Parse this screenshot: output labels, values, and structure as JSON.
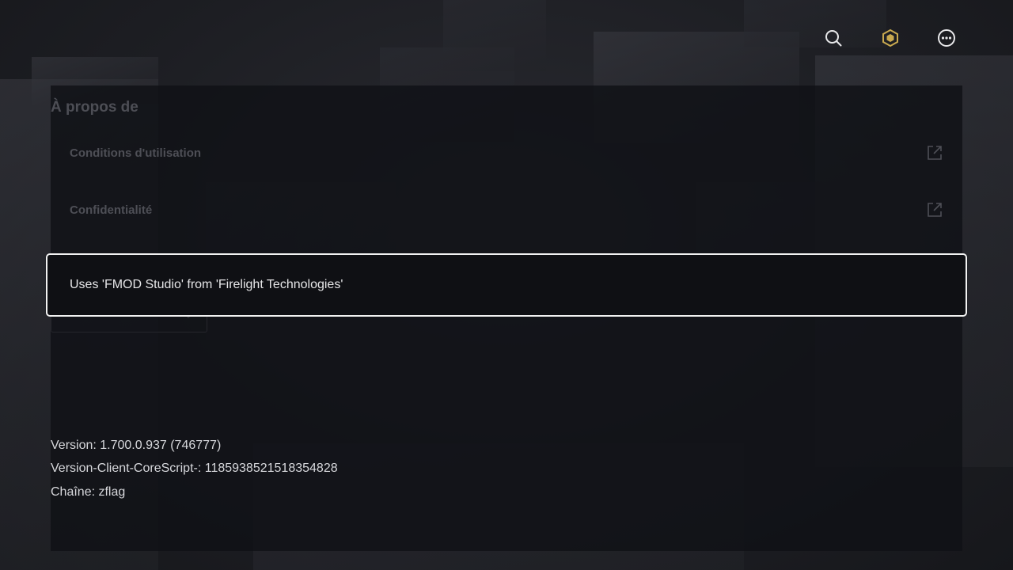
{
  "topbar": {
    "icons": [
      "search-icon",
      "robux-icon",
      "more-options-icon"
    ],
    "colors": {
      "icon": "#e8e8ea",
      "robux": "#c9a94f"
    }
  },
  "about": {
    "title": "À propos de",
    "items": [
      {
        "label": "Conditions d'utilisation",
        "icon": "external-link-icon"
      },
      {
        "label": "Confidentialité",
        "icon": "external-link-icon"
      }
    ]
  },
  "highlight": {
    "text": "Uses 'FMOD Studio' from 'Firelight Technologies'"
  },
  "info": {
    "version": "Version: 1.700.0.937 (746777)",
    "corescript": "Version-Client-CoreScript-: 1185938521518354828",
    "channel": "Chaîne: zflag"
  },
  "colors": {
    "background": "#1c1d22",
    "panel": "#101116",
    "highlight_border": "#f2f2f2",
    "dim_text": "#4e4f56",
    "text": "#e6e6e8"
  }
}
